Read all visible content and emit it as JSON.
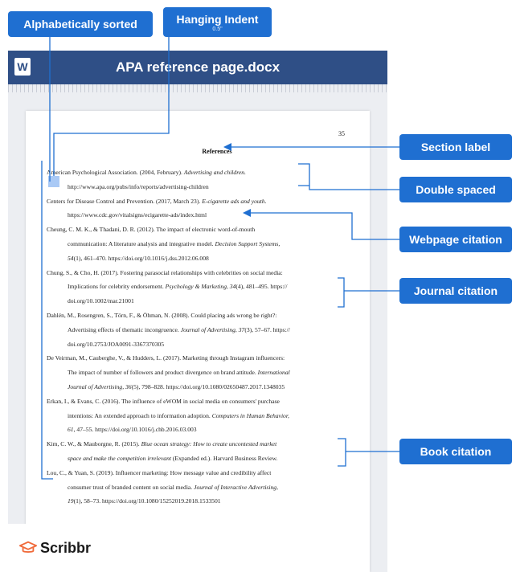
{
  "callouts": {
    "alphabetically_sorted": "Alphabetically sorted",
    "hanging_indent": "Hanging Indent",
    "hanging_indent_sub": "0.5\"",
    "section_label": "Section label",
    "double_spaced": "Double spaced",
    "webpage_citation": "Webpage citation",
    "journal_citation": "Journal citation",
    "book_citation": "Book citation"
  },
  "document": {
    "title": "APA reference page.docx",
    "word_icon": "W",
    "page_number": "35",
    "heading": "References",
    "lines": [
      {
        "a": "American Psychological Association. (2004, February). ",
        "i": "Advertising and children.",
        "b": ""
      },
      {
        "a": "http://www.apa.org/pubs/info/reports/advertising-children",
        "i": "",
        "b": ""
      },
      {
        "a": "Centers for Disease Control and Prevention. (2017, March 23). ",
        "i": "E-cigarette ads and youth.",
        "b": ""
      },
      {
        "a": "https://www.cdc.gov/vitalsigns/ecigarette-ads/index.html",
        "i": "",
        "b": ""
      },
      {
        "a": "Cheung, C. M. K., & Thadani, D. R. (2012). The impact of electronic word-of-mouth",
        "i": "",
        "b": ""
      },
      {
        "a": "communication: A literature analysis and integrative model. ",
        "i": "Decision Support Systems,",
        "b": ""
      },
      {
        "a": "",
        "i": "54",
        "b": "(1), 461–470. https://doi.org/10.1016/j.dss.2012.06.008"
      },
      {
        "a": "Chung, S., & Cho, H. (2017). Fostering parasocial relationships with celebrities on social media:",
        "i": "",
        "b": ""
      },
      {
        "a": "Implications for celebrity endorsement. ",
        "i": "Psychology & Marketing, 34",
        "b": "(4), 481–495. https://"
      },
      {
        "a": "doi.org/10.1002/mar.21001",
        "i": "",
        "b": ""
      },
      {
        "a": "Dahlén, M., Rosengren, S., Törn, F., & Öhman, N. (2008). Could placing ads wrong be right?:",
        "i": "",
        "b": ""
      },
      {
        "a": "Advertising effects of thematic incongruence. ",
        "i": "Journal of Advertising, 37",
        "b": "(3), 57–67. https://"
      },
      {
        "a": "doi.org/10.2753/JOA0091-3367370305",
        "i": "",
        "b": ""
      },
      {
        "a": "De Veirman, M., Cauberghe, V., & Hudders, L. (2017). Marketing through Instagram influencers:",
        "i": "",
        "b": ""
      },
      {
        "a": "The impact of number of followers and product divergence on brand attitude. ",
        "i": "International",
        "b": ""
      },
      {
        "a": "",
        "i": "Journal of Advertising, 36",
        "b": "(5), 798–828. https://doi.org/10.1080/02650487.2017.1348035"
      },
      {
        "a": "Erkan, I., & Evans, C. (2016). The influence of eWOM in social media on consumers' purchase",
        "i": "",
        "b": ""
      },
      {
        "a": "intentions: An extended approach to information adoption. ",
        "i": "Computers in Human Behavior,",
        "b": ""
      },
      {
        "a": "",
        "i": "61",
        "b": ", 47–55. https://doi.org/10.1016/j.chb.2016.03.003"
      },
      {
        "a": "Kim, C. W., & Mauborgne, R. (2015). ",
        "i": "Blue ocean strategy: How to create uncontested market",
        "b": ""
      },
      {
        "a": "",
        "i": "space and make the competition irrelevant",
        "b": " (Expanded ed.). Harvard Business Review."
      },
      {
        "a": "Lou, C., & Yuan, S. (2019). Influencer marketing: How message value and credibility affect",
        "i": "",
        "b": ""
      },
      {
        "a": "consumer trust of branded content on social media. ",
        "i": "Journal of Interactive Advertising,",
        "b": ""
      },
      {
        "a": "",
        "i": "19",
        "b": "(1), 58–73. https://doi.org/10.1080/15252019.2018.1533501"
      }
    ]
  },
  "brand": {
    "name": "Scribbr",
    "icon": "scribbr-mortarboard-icon"
  },
  "colors": {
    "callout_blue": "#1f6fd1",
    "header_navy": "#2f4f86",
    "line_blue": "#1f6fd1",
    "indent_box": "#a9c9f5"
  }
}
